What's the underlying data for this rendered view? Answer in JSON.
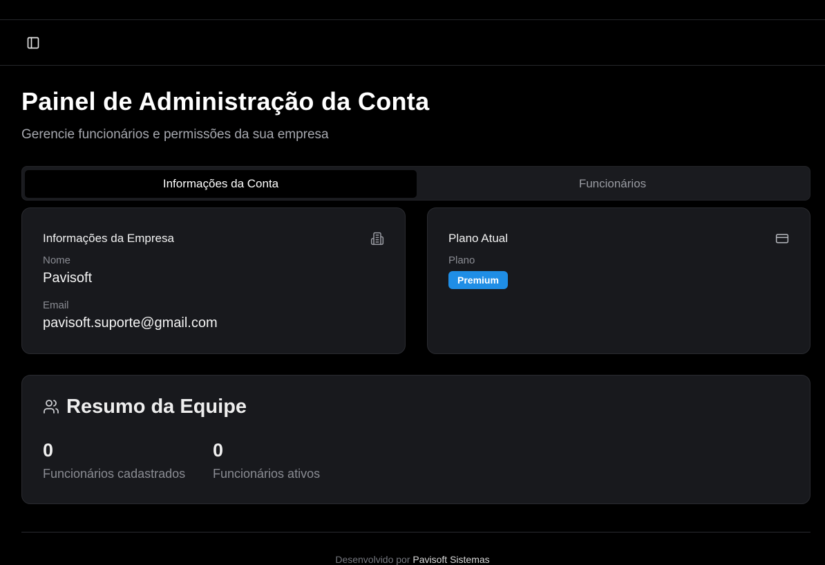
{
  "header": {
    "sidebar_toggle_icon": "panel-left-icon"
  },
  "page": {
    "title": "Painel de Administração da Conta",
    "subtitle": "Gerencie funcionários e permissões da sua empresa"
  },
  "tabs": [
    {
      "label": "Informações da Conta",
      "active": true
    },
    {
      "label": "Funcionários",
      "active": false
    }
  ],
  "company_card": {
    "title": "Informações da Empresa",
    "icon": "building-icon",
    "name_label": "Nome",
    "name_value": "Pavisoft",
    "email_label": "Email",
    "email_value": "pavisoft.suporte@gmail.com"
  },
  "plan_card": {
    "title": "Plano Atual",
    "icon": "credit-card-icon",
    "plan_label": "Plano",
    "plan_value": "Premium",
    "badge_color": "#1f8ee6"
  },
  "team_card": {
    "title": "Resumo da Equipe",
    "icon": "users-icon",
    "stats": [
      {
        "value": "0",
        "label": "Funcionários cadastrados"
      },
      {
        "value": "0",
        "label": "Funcionários ativos"
      }
    ]
  },
  "footer": {
    "prefix": "Desenvolvido por",
    "brand": "Pavisoft Sistemas"
  }
}
